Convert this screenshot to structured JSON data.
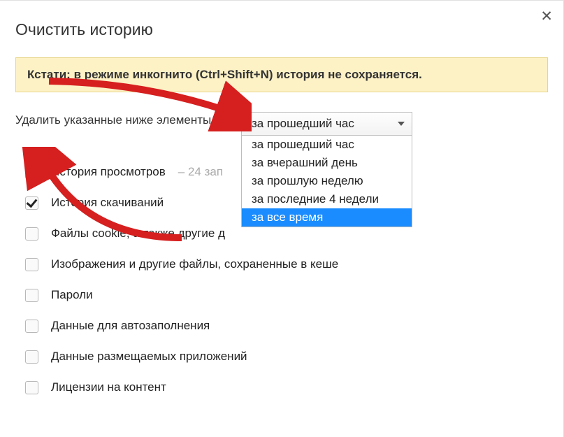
{
  "title": "Очистить историю",
  "info_prefix": "Кстати: ",
  "info_text": "в режиме инкогнито (Ctrl+Shift+N) история не сохраняется.",
  "time_label": "Удалить указанные ниже элементы",
  "dropdown": {
    "selected": "за прошедший час",
    "options": [
      "за прошедший час",
      "за вчерашний день",
      "за прошлую неделю",
      "за последние 4 недели",
      "за все время"
    ],
    "highlighted_index": 4
  },
  "checkboxes": [
    {
      "label": "История просмотров",
      "suffix": "  –  24 зап",
      "checked": true
    },
    {
      "label": "История скачиваний",
      "suffix": "",
      "checked": true
    },
    {
      "label": "Файлы cookie, а также другие д",
      "suffix": "",
      "checked": false
    },
    {
      "label": "Изображения и другие файлы, сохраненные в кеше",
      "suffix": "",
      "checked": false
    },
    {
      "label": "Пароли",
      "suffix": "",
      "checked": false
    },
    {
      "label": "Данные для автозаполнения",
      "suffix": "",
      "checked": false
    },
    {
      "label": "Данные размещаемых приложений",
      "suffix": "",
      "checked": false
    },
    {
      "label": "Лицензии на контент",
      "suffix": "",
      "checked": false
    }
  ],
  "colors": {
    "annotation": "#d61f1f"
  }
}
